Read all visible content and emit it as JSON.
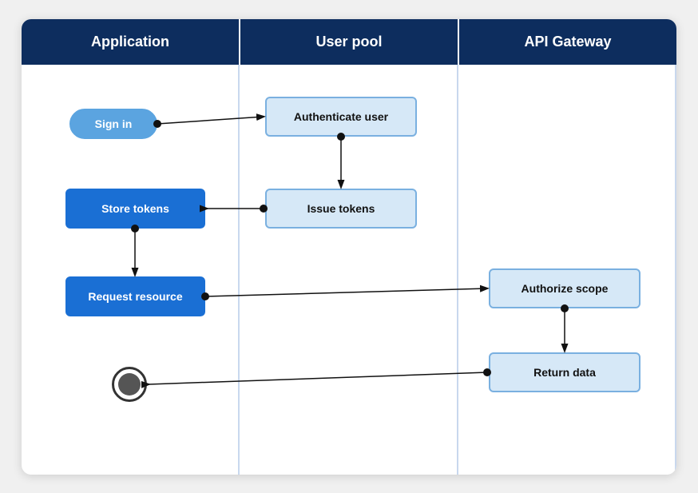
{
  "header": {
    "col1": "Application",
    "col2": "User pool",
    "col3": "API Gateway"
  },
  "nodes": {
    "sign_in": "Sign in",
    "authenticate_user": "Authenticate user",
    "store_tokens": "Store tokens",
    "issue_tokens": "Issue tokens",
    "request_resource": "Request resource",
    "authorize_scope": "Authorize scope",
    "return_data": "Return data"
  },
  "colors": {
    "header_bg": "#0d2d5e",
    "node_blue": "#1a6fd4",
    "node_light_bg": "#d6e8f7",
    "node_light_border": "#7ab0e0",
    "pill_bg": "#5ba4e0",
    "arrow": "#111",
    "dot": "#111"
  }
}
